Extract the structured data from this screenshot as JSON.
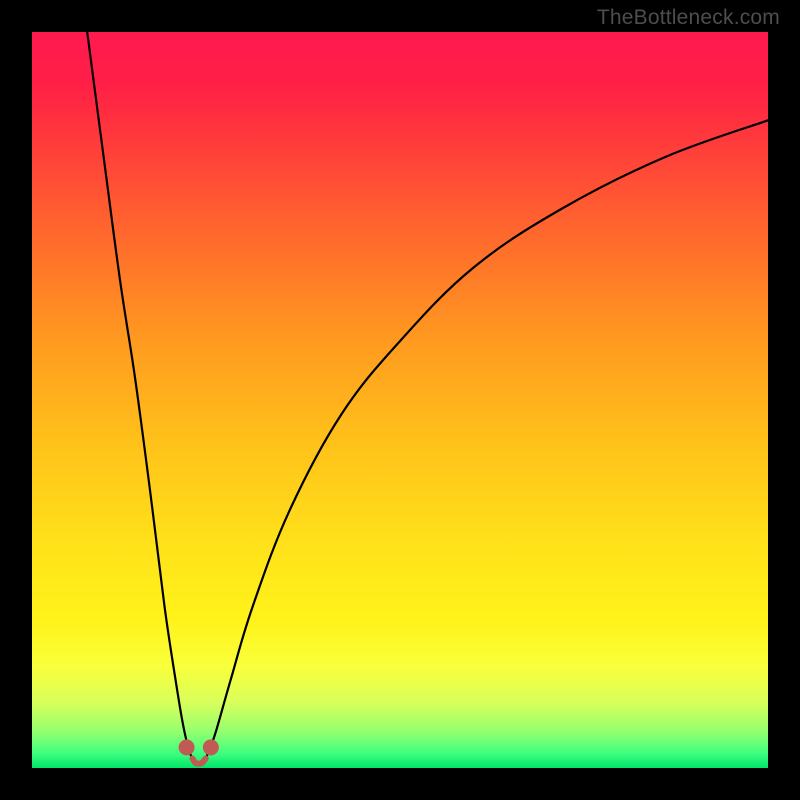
{
  "watermark": "TheBottleneck.com",
  "gradient_stops": [
    {
      "offset": 0.0,
      "color": "#ff1a4f"
    },
    {
      "offset": 0.07,
      "color": "#ff1f46"
    },
    {
      "offset": 0.15,
      "color": "#ff3b3b"
    },
    {
      "offset": 0.28,
      "color": "#ff6a2c"
    },
    {
      "offset": 0.42,
      "color": "#ff9a1f"
    },
    {
      "offset": 0.56,
      "color": "#ffc21a"
    },
    {
      "offset": 0.7,
      "color": "#ffe21a"
    },
    {
      "offset": 0.8,
      "color": "#fff31a"
    },
    {
      "offset": 0.86,
      "color": "#faff3a"
    },
    {
      "offset": 0.91,
      "color": "#d9ff5a"
    },
    {
      "offset": 0.95,
      "color": "#96ff6e"
    },
    {
      "offset": 0.98,
      "color": "#3fff80"
    },
    {
      "offset": 1.0,
      "color": "#00e56a"
    }
  ],
  "chart_data": {
    "type": "line",
    "title": "",
    "xlabel": "",
    "ylabel": "",
    "xlim": [
      0,
      100
    ],
    "ylim": [
      0,
      100
    ],
    "x_optimum": 22,
    "series": [
      {
        "name": "left-branch",
        "x": [
          7.5,
          10,
          12,
          14,
          16,
          18,
          19.5,
          20.5,
          21.3,
          21.8
        ],
        "values": [
          100,
          81,
          66,
          53,
          38,
          22,
          12,
          6,
          2.5,
          1.3
        ]
      },
      {
        "name": "right-branch",
        "x": [
          23.6,
          24.1,
          25,
          27,
          30,
          35,
          42,
          50,
          60,
          72,
          86,
          100
        ],
        "values": [
          1.3,
          2.5,
          5,
          12,
          22,
          35,
          48,
          58,
          68,
          76,
          83,
          88
        ]
      },
      {
        "name": "valley-floor",
        "x": [
          21.8,
          22.2,
          22.7,
          23.1,
          23.6
        ],
        "values": [
          1.3,
          0.7,
          0.6,
          0.7,
          1.3
        ]
      }
    ],
    "markers": [
      {
        "name": "valley-marker-left",
        "x": 21.0,
        "y": 2.8
      },
      {
        "name": "valley-marker-right",
        "x": 24.3,
        "y": 2.8
      }
    ],
    "marker_color": "#c05a52",
    "marker_radius_px": 8
  }
}
